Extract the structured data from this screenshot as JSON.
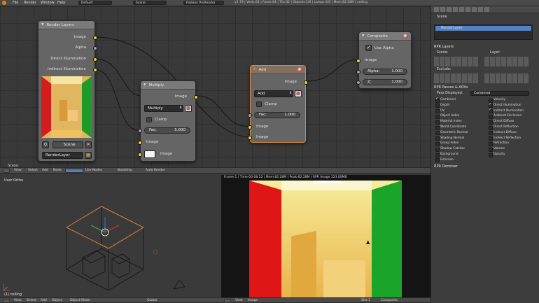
{
  "topbar": {
    "menus": [
      "File",
      "Render",
      "Window",
      "Help"
    ],
    "layout": "Default",
    "scene": "Scene",
    "engine": "Radeon ProRender",
    "stats": "v2.79 | Verts:64 | Faces:64 | Tris:32 | Objects:1/8 | Lamps:0/0 | Mem:82.28M | ceiling"
  },
  "node_editor": {
    "scene_label": "Scene",
    "render_layers": {
      "title": "Render Layers",
      "outputs": [
        "Image",
        "Alpha",
        "Direct Illumination",
        "Indirect Illumination"
      ],
      "scene_field": "Scene",
      "layer_field": "RenderLayer"
    },
    "multiply": {
      "title": "Multiply",
      "output": "Image",
      "mode": "Multiply",
      "clamp": "Clamp",
      "fac_label": "Fac:",
      "fac_value": "5.000",
      "inputs": [
        "Image",
        "Image"
      ]
    },
    "add": {
      "title": "Add",
      "output": "Image",
      "mode": "Add",
      "clamp": "Clamp",
      "fac_label": "Fac:",
      "fac_value": "1.000",
      "inputs": [
        "Image",
        "Image"
      ]
    },
    "composite": {
      "title": "Composite",
      "use_alpha": "Use Alpha",
      "input": "Image",
      "alpha_label": "Alpha:",
      "alpha_value": "1.000",
      "z_label": "Z:",
      "z_value": "1.000"
    }
  },
  "node_header": {
    "items": [
      "View",
      "Select",
      "Add",
      "Node"
    ],
    "use_nodes": "Use Nodes",
    "backdrop": "Backdrop",
    "auto_render": "Auto Render"
  },
  "viewport": {
    "label": "User Ortho",
    "object_label": "(1) ceiling",
    "header_items": [
      "View",
      "Select",
      "Add",
      "Object"
    ],
    "mode": "Object Mode",
    "orientation": "Global"
  },
  "render_view": {
    "frame_info": "Frame:1 | Time:00:08.52 | Mem:82.28M | Peak:82.28M | RPR Image 123.00MB",
    "header_items": [
      "View",
      "Image"
    ],
    "slot": "Slot 1",
    "pass": "Composite"
  },
  "properties": {
    "scene_label": "Scene",
    "layer_item": "RenderLayer",
    "rpr_layers": "RPR Layers",
    "scene_sub": "Scene:",
    "layer_sub": "Layer:",
    "exclude": "Exclude:",
    "passes_title": "RPR Passes & AOVs",
    "pass_displayed_label": "Pass Displayed:",
    "pass_displayed_value": "Combined",
    "passes_left": [
      "Combined",
      "Depth",
      "UV",
      "Object Index",
      "Material Index",
      "World Coordinate",
      "Geometric Normal",
      "Shading Normal",
      "Group Index",
      "Shadow Catcher",
      "Background",
      "Emission"
    ],
    "passes_right": [
      "Velocity",
      "Direct Illumination",
      "Indirect Illumination",
      "Ambient Occlusion",
      "Direct Diffuse",
      "Direct Reflection",
      "Indirect Diffuse",
      "Indirect Reflection",
      "Refraction",
      "Volume",
      "Opacity"
    ],
    "checked_left": [
      true,
      false,
      false,
      false,
      false,
      false,
      false,
      false,
      false,
      false,
      false,
      false
    ],
    "checked_right": [
      false,
      true,
      true,
      false,
      false,
      false,
      false,
      false,
      false,
      false,
      false
    ],
    "denoiser": "RPR Denoiser"
  },
  "colors": {
    "accent": "#e0883a",
    "socket": "#e8d722",
    "selection": "#5680c2"
  }
}
